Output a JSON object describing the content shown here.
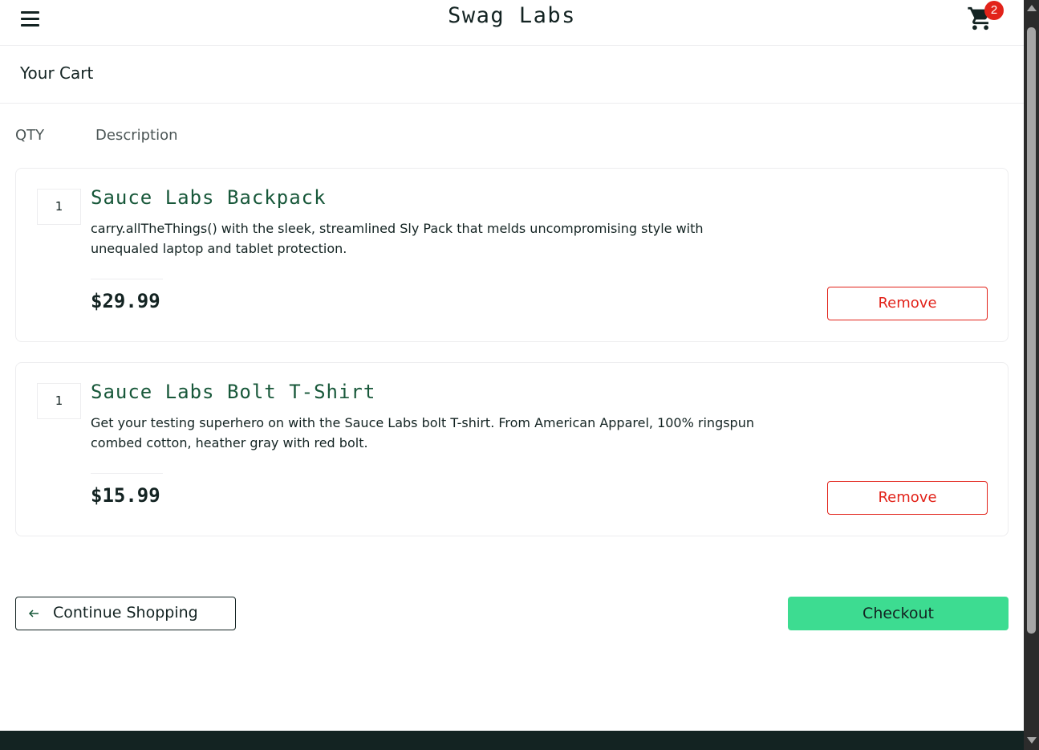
{
  "header": {
    "app_title": "Swag Labs",
    "menu_icon": "hamburger-menu-icon",
    "cart_icon": "shopping-cart-icon",
    "cart_badge": "2"
  },
  "page": {
    "title": "Your Cart"
  },
  "columns": {
    "qty": "QTY",
    "description": "Description"
  },
  "items": [
    {
      "quantity": "1",
      "name": "Sauce Labs Backpack",
      "description_line1": "carry.allTheThings() with the sleek, streamlined Sly Pack that melds uncompromising style with",
      "description_line2": "unequaled laptop and tablet protection.",
      "price": "$29.99",
      "remove_label": "Remove"
    },
    {
      "quantity": "1",
      "name": "Sauce Labs Bolt T-Shirt",
      "description_line1": "Get your testing superhero on with the Sauce Labs bolt T-shirt. From American Apparel, 100% ringspun",
      "description_line2": "combed cotton, heather gray with red bolt.",
      "price": "$15.99",
      "remove_label": "Remove"
    }
  ],
  "actions": {
    "continue_label": "Continue Shopping",
    "continue_icon": "arrow-left-icon",
    "checkout_label": "Checkout"
  },
  "colors": {
    "brand_dark": "#132322",
    "item_name": "#18583a",
    "remove_red": "#e2231a",
    "checkout_green": "#3ddc91",
    "badge_red": "#e2231a"
  }
}
